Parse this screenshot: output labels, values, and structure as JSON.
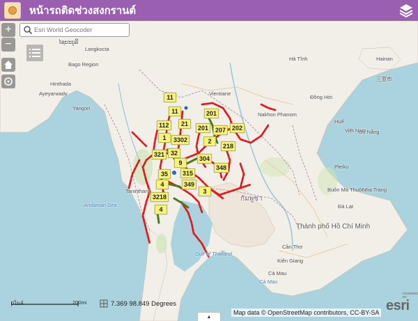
{
  "app": {
    "title": "หน้ารถติดช่วงสงกรานต์"
  },
  "search": {
    "placeholder": "Esri World Geocoder"
  },
  "icons": {
    "zoom_in": "+",
    "zoom_out": "−",
    "home": "home-icon",
    "locate": "locate-icon",
    "layers": "layers-icon",
    "list": "list-icon",
    "search": "search-icon",
    "coords": "coords-icon",
    "caret_up": "▲"
  },
  "colors": {
    "title_bar": "#9b5fb1",
    "route_red": "#e31a1c",
    "route_green": "#4d7a1a",
    "label_fill": "#f6f37a",
    "water": "#aad3df",
    "land": "#f2efe9"
  },
  "places": [
    {
      "text": "ໄຊຍະບູລີ",
      "cls": "place"
    },
    {
      "text": "Vientiane",
      "cls": "place"
    },
    {
      "text": "Nakhon Phanom",
      "cls": "place"
    },
    {
      "text": "Hà Tĩnh",
      "cls": "place"
    },
    {
      "text": "Đồng Hới",
      "cls": "place"
    },
    {
      "text": "Huế",
      "cls": "place"
    },
    {
      "text": "Đà Nẵng",
      "cls": "place"
    },
    {
      "text": "Việt Nam",
      "cls": "place country"
    },
    {
      "text": "Pleiku",
      "cls": "place"
    },
    {
      "text": "Buôn Ma Thuột",
      "cls": "place"
    },
    {
      "text": "Nha Trang",
      "cls": "place"
    },
    {
      "text": "Đà Lạt",
      "cls": "place"
    },
    {
      "text": "Thành phố Hồ Chí Minh",
      "cls": "place big"
    },
    {
      "text": "Cần Thơ",
      "cls": "place"
    },
    {
      "text": "Cà Mau",
      "cls": "place"
    },
    {
      "text": "กัมพูชา",
      "cls": "place country"
    },
    {
      "text": "Kiên Giang",
      "cls": "place"
    },
    {
      "text": "Hainan",
      "cls": "place"
    },
    {
      "text": "三亚市",
      "cls": "place"
    },
    {
      "text": "Langkocta",
      "cls": "place"
    },
    {
      "text": "Bago Region",
      "cls": "place"
    },
    {
      "text": "Ayeyarwady",
      "cls": "place"
    },
    {
      "text": "Hinthada",
      "cls": "place"
    },
    {
      "text": "Yangon",
      "cls": "place"
    },
    {
      "text": "Tanintharyi",
      "cls": "place"
    },
    {
      "text": "Cà Mau",
      "cls": "place sea"
    },
    {
      "text": "Gulf of Thailand",
      "cls": "place sea"
    },
    {
      "text": "Andaman Sea",
      "cls": "place sea"
    }
  ],
  "route_labels": [
    "11",
    "11",
    "112",
    "21",
    "201",
    "201",
    "207",
    "202",
    "1",
    "3302",
    "2",
    "218",
    "321",
    "32",
    "9",
    "304",
    "348",
    "35",
    "315",
    "4",
    "349",
    "3",
    "3218",
    "4"
  ],
  "scale": {
    "left_label": "0ไมล์",
    "right_label": "200mi"
  },
  "coords": {
    "text": "7.369  98.849 Degrees"
  },
  "attribution": {
    "text": "Map data © OpenStreetMap contributors, CC-BY-SA"
  },
  "esri": {
    "logo": "esri",
    "powered": "POWERED BY"
  }
}
